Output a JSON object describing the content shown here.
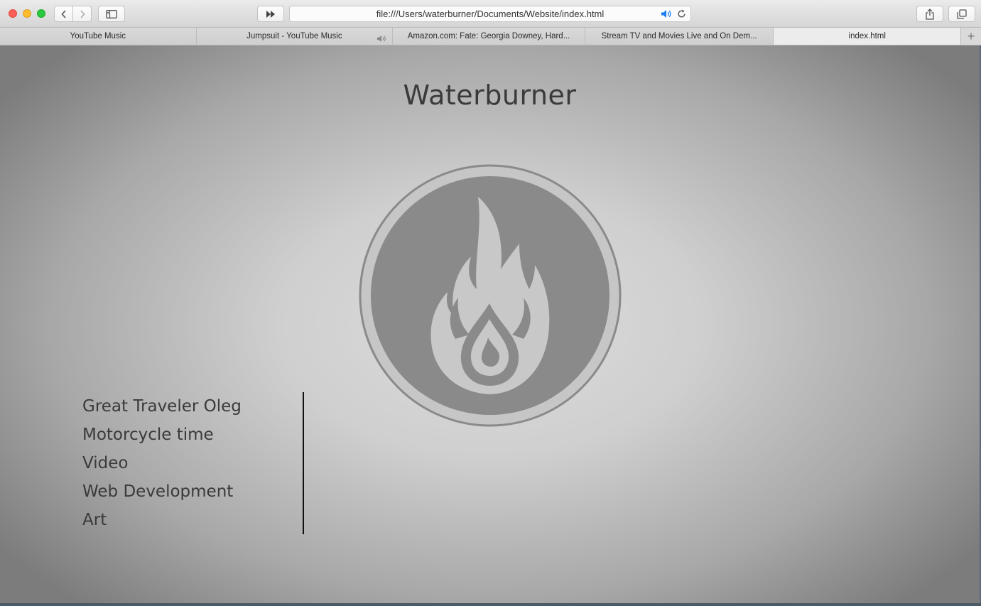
{
  "browser": {
    "url": "file:///Users/waterburner/Documents/Website/index.html",
    "icons": {
      "close": "close-dot",
      "minimize": "minimize-dot",
      "maximize": "maximize-dot",
      "back": "chevron-left-icon",
      "forward": "chevron-right-icon",
      "sidebar": "sidebar-icon",
      "skip": "fast-forward-icon",
      "audio": "speaker-icon",
      "reload": "reload-icon",
      "share": "share-icon",
      "tabs": "tabs-overview-icon"
    },
    "tabs": [
      {
        "label": "YouTube Music"
      },
      {
        "label": "Jumpsuit - YouTube Music"
      },
      {
        "label": "Amazon.com: Fate: Georgia Downey, Hard..."
      },
      {
        "label": "Stream TV and Movies Live and On Dem..."
      },
      {
        "label": "index.html"
      }
    ],
    "new_tab": "+"
  },
  "page": {
    "title": "Waterburner",
    "logo_colors": {
      "ring": "#888888",
      "inner": "#8a8a8a",
      "flame": "#c8c8c8"
    },
    "nav": [
      {
        "label": "Great Traveler Oleg"
      },
      {
        "label": "Motorcycle time"
      },
      {
        "label": "Video"
      },
      {
        "label": "Web Development"
      },
      {
        "label": "Art"
      }
    ]
  }
}
